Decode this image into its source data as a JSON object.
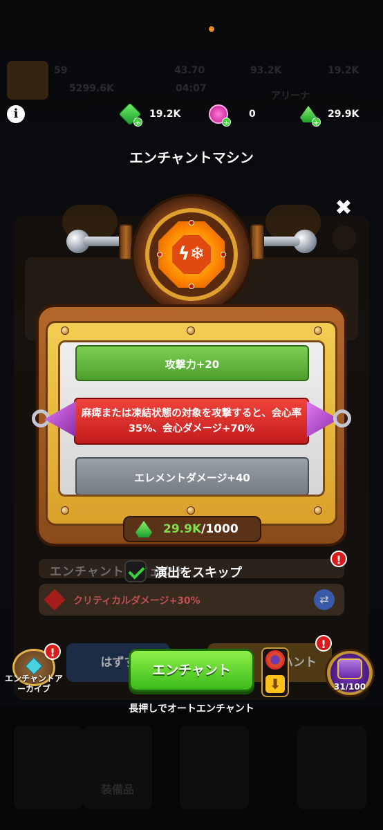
{
  "background": {
    "stats": [
      "59",
      "5299.6K",
      "43.70",
      "93.2K",
      "19.2K",
      "04:07"
    ],
    "arena_label": "アリーナ",
    "bottom_label": "装備品"
  },
  "currencies": [
    {
      "icon": "green-gem-icon",
      "value": "19.2K"
    },
    {
      "icon": "pink-crystal-icon",
      "value": "0"
    },
    {
      "icon": "green-shard-icon",
      "value": "29.9K"
    }
  ],
  "title": "エンチャントマシン",
  "options": {
    "top": "攻撃力+20",
    "selected": "麻痺または凍結状態の対象を攻撃すると、会心率35%、会心ダメージ+70%",
    "bottom": "エレメントダメージ+40"
  },
  "cost": {
    "have": "29.9K",
    "need": "/1000"
  },
  "skip": {
    "label": "演出をスキップ",
    "checked": true,
    "background_text": "エンチャントエフェクト"
  },
  "current_effect": "クリティカルダメージ+30%",
  "buttons": {
    "enchant": "エンチャント",
    "hold_hint": "長押しでオートエンチャント",
    "remove_ghost": "はずす",
    "right_ghost": "ハント"
  },
  "archive": {
    "label": "エンチャントアーカイブ",
    "badge": "!"
  },
  "chest": {
    "progress": "31/100"
  },
  "badges": {
    "alert": "!"
  },
  "colors": {
    "accent_green": "#4ea02c",
    "selected_red": "#c21c1c",
    "have_green": "#7ee04a",
    "frame_gold": "#d9a02a"
  }
}
